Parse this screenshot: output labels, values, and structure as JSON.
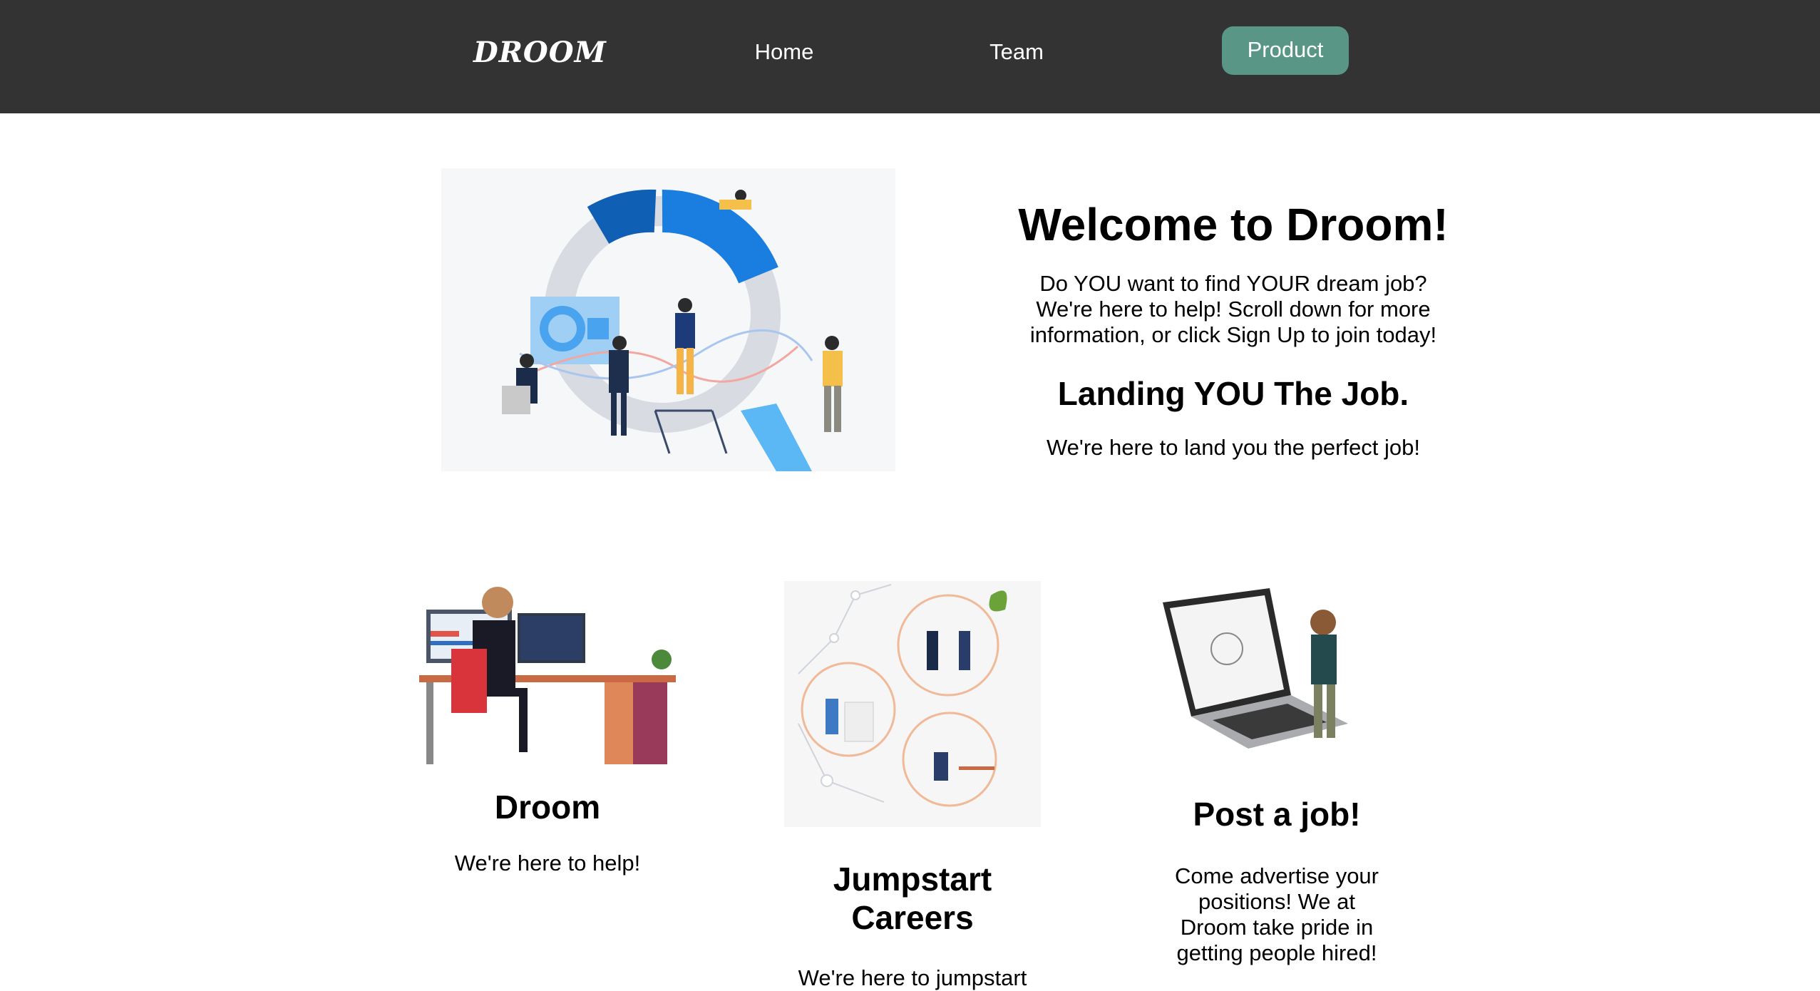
{
  "nav": {
    "logo": "DROOM",
    "links": [
      "Home",
      "Team"
    ],
    "cta": "Product"
  },
  "hero": {
    "title": "Welcome to Droom!",
    "description": "Do YOU want to find YOUR dream job? We're here to help! Scroll down for more information, or click Sign Up to join today!",
    "subtitle": "Landing YOU The Job.",
    "tagline": "We're here to land you the perfect job!"
  },
  "cards": [
    {
      "title": "Droom",
      "text": "We're here to help!"
    },
    {
      "title": "Jumpstart Careers",
      "text": "We're here to jumpstart"
    },
    {
      "title": "Post a job!",
      "text": "Come advertise your positions! We at Droom take pride in getting people hired!"
    }
  ],
  "colors": {
    "navbar": "#333333",
    "accent": "#5a9686",
    "text": "#000000",
    "background": "#ffffff"
  }
}
